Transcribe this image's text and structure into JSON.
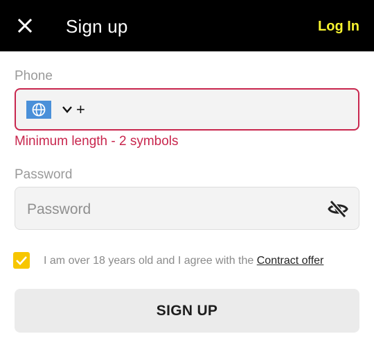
{
  "header": {
    "title": "Sign up",
    "close_icon": "close-icon",
    "login_label": "Log In"
  },
  "phone": {
    "label": "Phone",
    "country_icon": "globe-icon",
    "chevron_icon": "chevron-down-icon",
    "prefix": "+",
    "value": "",
    "error": "Minimum length - 2 symbols"
  },
  "password": {
    "label": "Password",
    "placeholder": "Password",
    "toggle_icon": "eye-off-icon"
  },
  "agreement": {
    "checked": true,
    "text": "I am over 18 years old and I agree with the ",
    "link_text": "Contract offer"
  },
  "signup_button": {
    "label": "SIGN UP"
  },
  "colors": {
    "header_bg": "#000000",
    "accent_yellow": "#f7f32f",
    "checkbox_yellow": "#f7c600",
    "error_red": "#c8264d",
    "flag_blue": "#4a90d9"
  }
}
